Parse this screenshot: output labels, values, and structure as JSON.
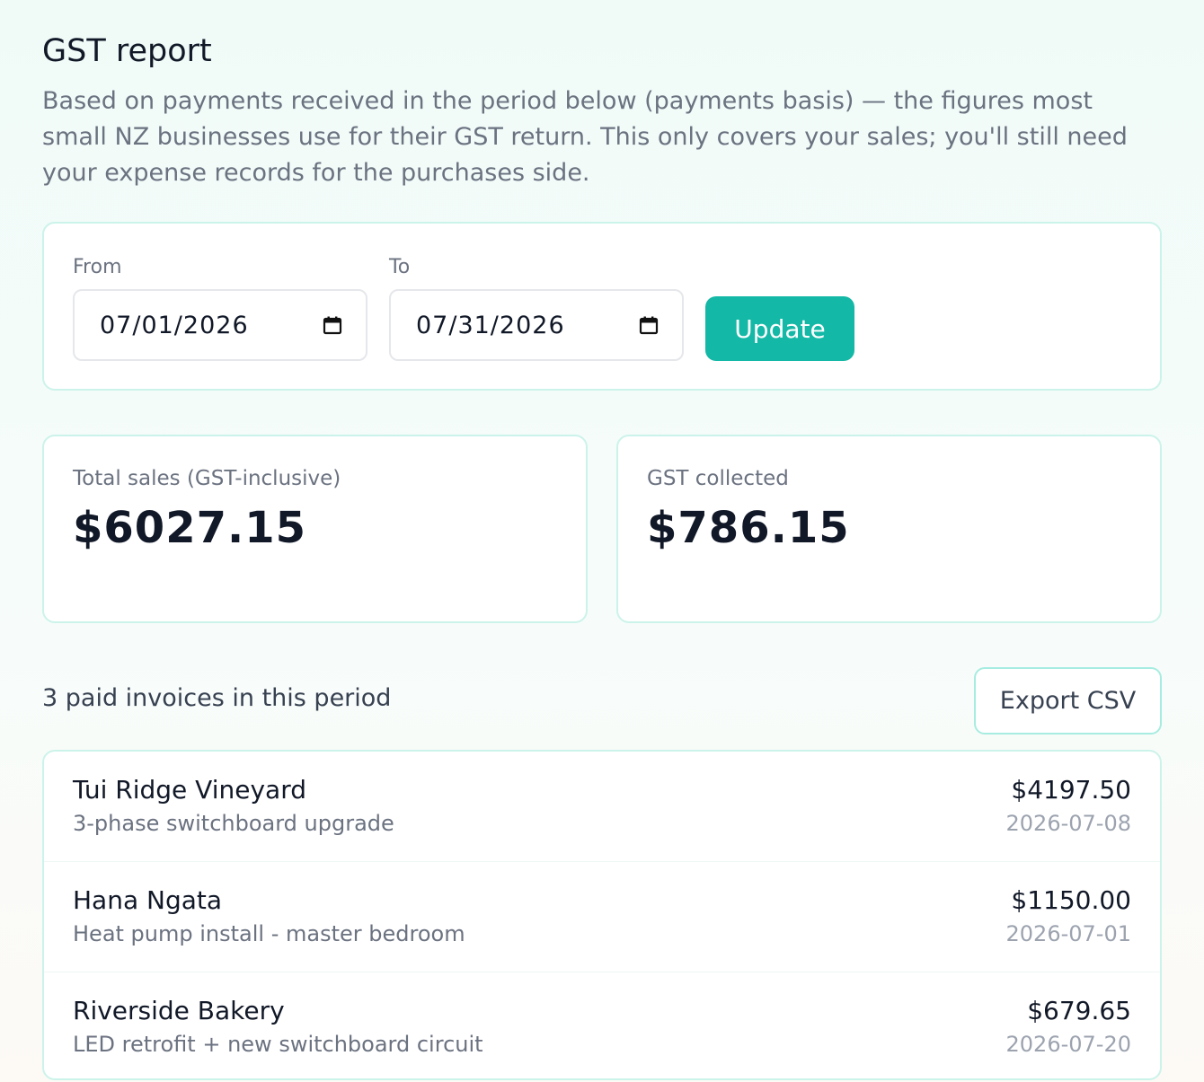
{
  "page": {
    "title": "GST report",
    "intro": "Based on payments received in the period below (payments basis) — the figures most small NZ businesses use for their GST return. This only covers your sales; you'll still need your expense records for the purchases side."
  },
  "filter": {
    "from_label": "From",
    "from_value": "07/01/2026",
    "to_label": "To",
    "to_value": "07/31/2026",
    "update_label": "Update"
  },
  "stats": {
    "total_label": "Total sales (GST-inclusive)",
    "total_value": "$6027.15",
    "gst_label": "GST collected",
    "gst_value": "$786.15"
  },
  "invoices": {
    "count_text": "3 paid invoices in this period",
    "export_label": "Export CSV",
    "items": [
      {
        "client": "Tui Ridge Vineyard",
        "description": "3-phase switchboard upgrade",
        "amount": "$4197.50",
        "date": "2026-07-08"
      },
      {
        "client": "Hana Ngata",
        "description": "Heat pump install - master bedroom",
        "amount": "$1150.00",
        "date": "2026-07-01"
      },
      {
        "client": "Riverside Bakery",
        "description": "LED retrofit + new switchboard circuit",
        "amount": "$679.65",
        "date": "2026-07-20"
      }
    ]
  },
  "colors": {
    "accent": "#14b8a6",
    "card_border": "#ccf3ea",
    "muted_text": "#6b7280"
  },
  "icons": {
    "date_picker": "calendar-icon"
  }
}
